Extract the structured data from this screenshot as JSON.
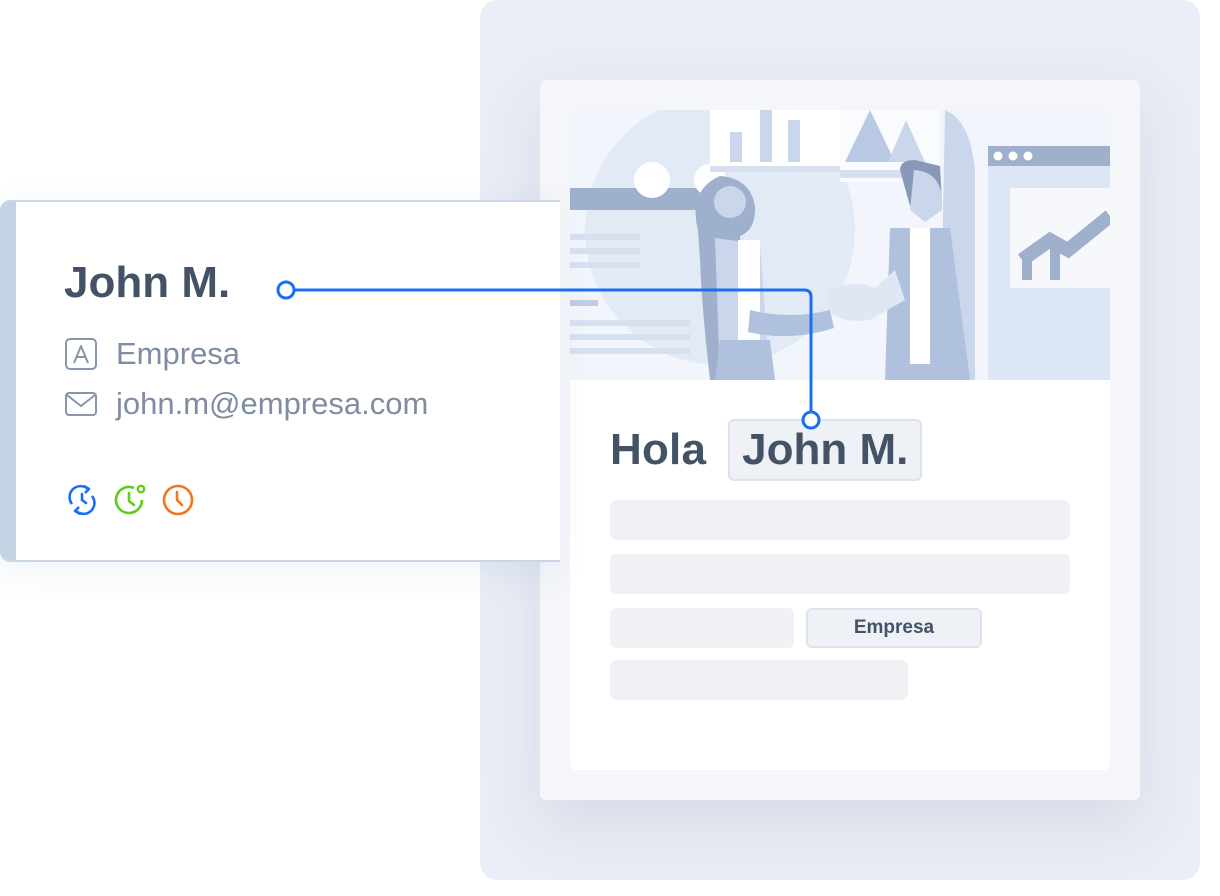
{
  "contact": {
    "name": "John M.",
    "company": "Empresa",
    "email": "john.m@empresa.com",
    "company_icon": "company-letter-a-icon",
    "email_icon": "envelope-icon"
  },
  "status_icons": [
    {
      "name": "sync-icon",
      "color": "#1a6ef5"
    },
    {
      "name": "clock-check-icon",
      "color": "#5fcd1a"
    },
    {
      "name": "clock-icon",
      "color": "#f4751c"
    }
  ],
  "email_preview": {
    "greeting": "Hola",
    "name_tag": "John M.",
    "company_tag": "Empresa"
  },
  "colors": {
    "connector": "#1a6ef5",
    "text": "#445266",
    "muted_text": "#7e8da2",
    "placeholder": "#eff1f5",
    "illustration": "#a8bde0"
  }
}
